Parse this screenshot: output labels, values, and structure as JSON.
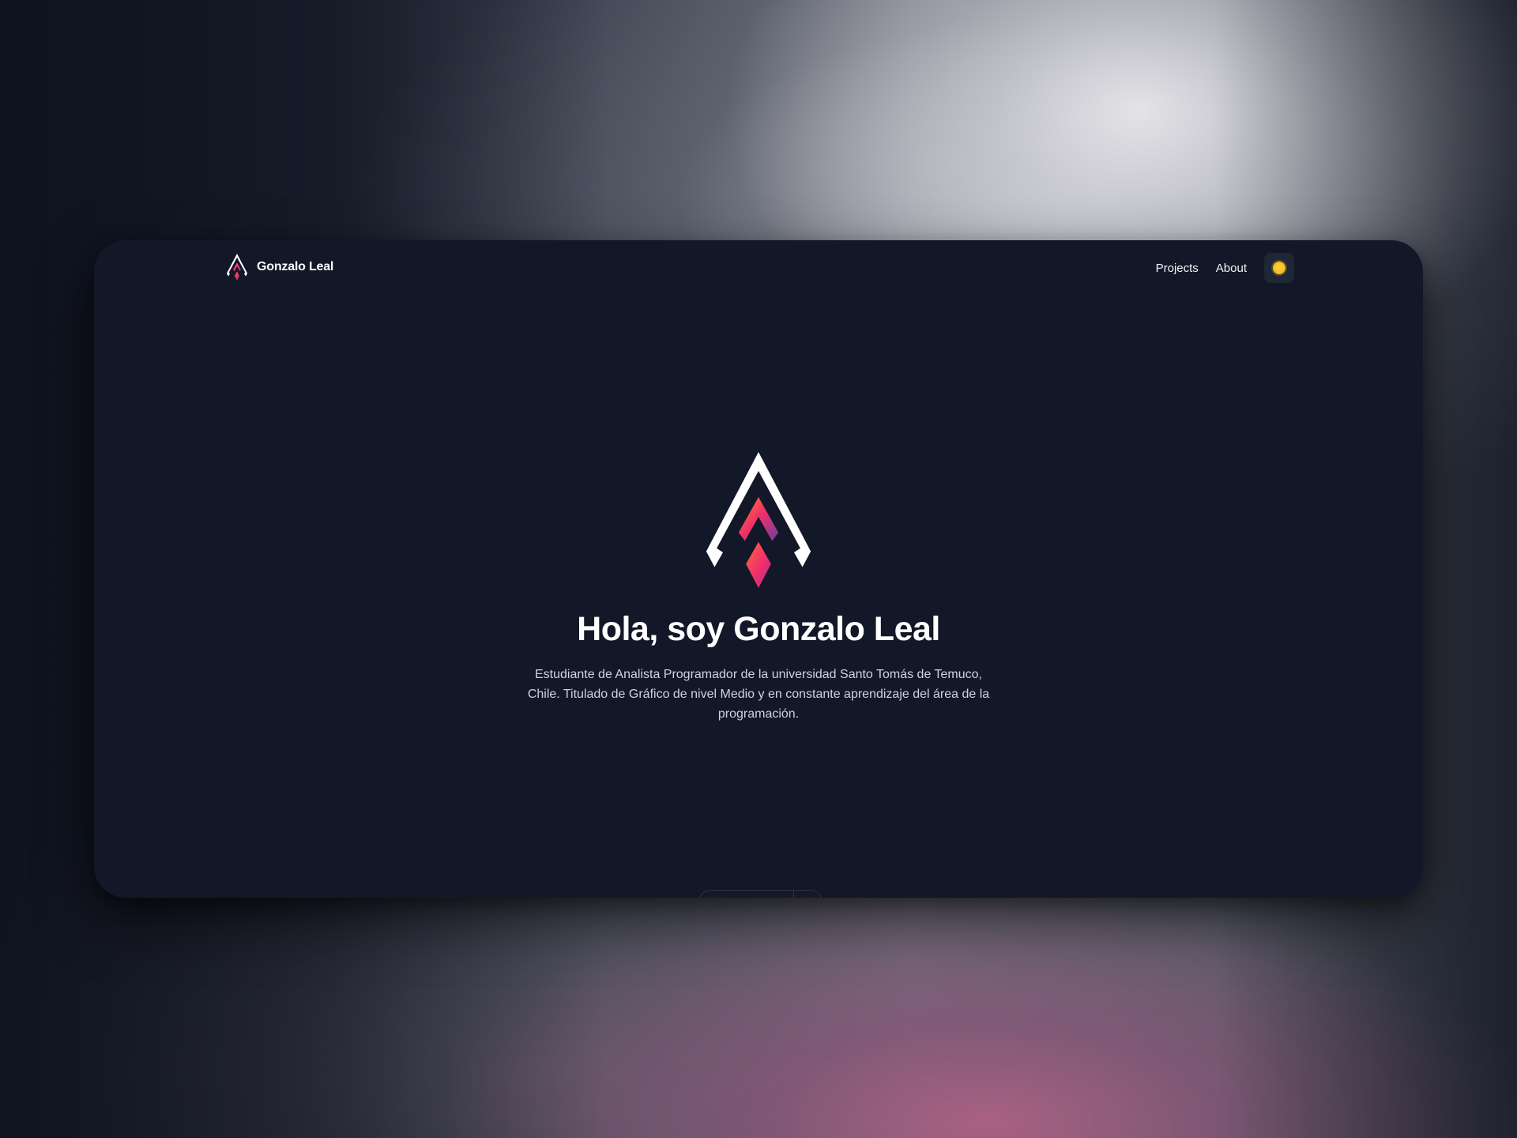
{
  "nav": {
    "brand_name": "Gonzalo Leal",
    "links": [
      {
        "label": "Projects"
      },
      {
        "label": "About"
      }
    ],
    "theme_toggle_icon": "sun-icon"
  },
  "hero": {
    "logo_icon": "gonzalo-leal-logo",
    "title": "Hola, soy Gonzalo Leal",
    "description": "Estudiante de Analista Programador de la universidad Santo Tomás de Temuco, Chile. Titulado de Gráfico de nivel Medio y en constante aprendizaje del área de la programación."
  },
  "colors": {
    "window_bg": "#121828",
    "accent_gradient_start": "#ff7a2f",
    "accent_gradient_mid": "#ef2f6a",
    "accent_gradient_end": "#6a3fa0",
    "sun": "#f6b71d"
  }
}
